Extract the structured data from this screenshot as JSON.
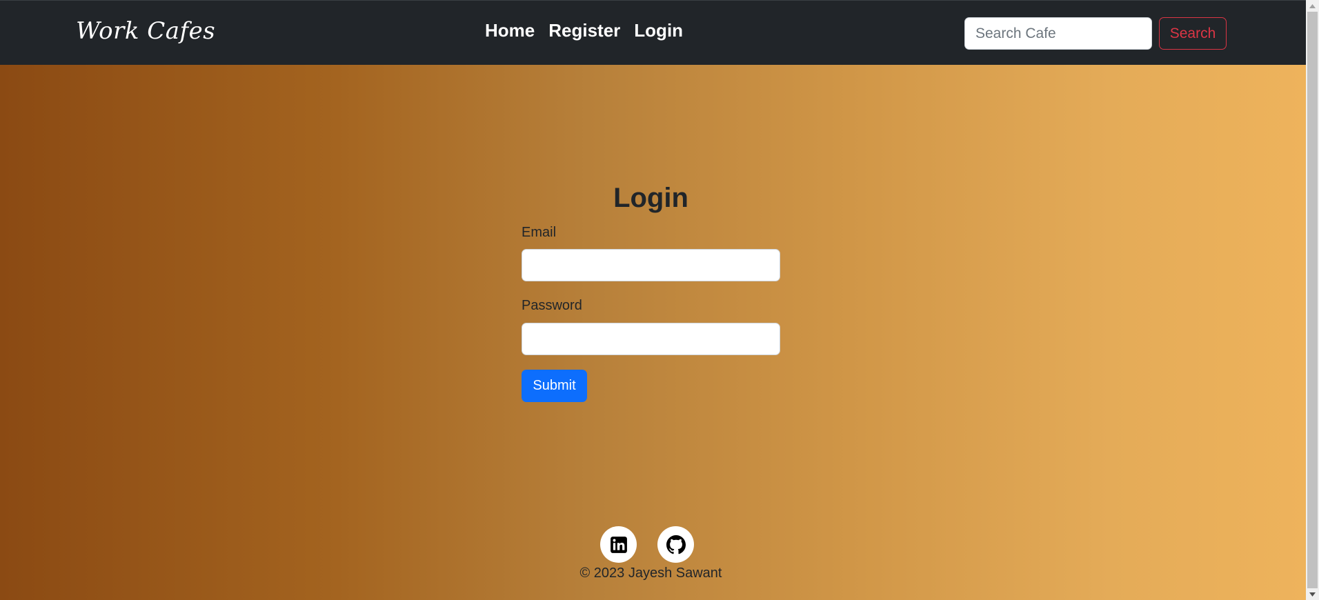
{
  "navbar": {
    "brand": "Work Cafes",
    "links": [
      "Home",
      "Register",
      "Login"
    ],
    "search_placeholder": "Search Cafe",
    "search_button": "Search"
  },
  "login": {
    "title": "Login",
    "email_label": "Email",
    "password_label": "Password",
    "email_value": "",
    "password_value": "",
    "submit_label": "Submit"
  },
  "footer": {
    "social_icons": [
      "linkedin-icon",
      "github-icon"
    ],
    "copyright": "© 2023 Jayesh Sawant"
  },
  "colors": {
    "navbar_bg": "#212529",
    "search_button": "#dc3545",
    "submit_button": "#0d6efd",
    "gradient_start": "#8b4a13",
    "gradient_end": "#eeb35c"
  }
}
